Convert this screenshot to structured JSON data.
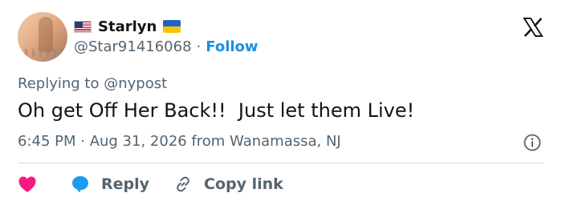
{
  "author": {
    "name": "Starlyn",
    "handle": "@Star91416068",
    "separator": "·",
    "follow_label": "Follow",
    "name_flags": [
      "us-flag-icon",
      "ukraine-flag-icon"
    ]
  },
  "reply_context": {
    "prefix": "Replying to",
    "handle": "@nypost"
  },
  "tweet": {
    "text": "Oh get Off Her Back!!  Just let them Live!",
    "meta": "6:45 PM · Aug 31, 2026 from Wanamassa, NJ"
  },
  "actions": {
    "like_icon": "heart-icon",
    "reply_label": "Reply",
    "copy_link_label": "Copy link"
  },
  "colors": {
    "accent": "#1d9bf0",
    "like": "#f91880",
    "muted": "#536471",
    "text": "#0f1419"
  },
  "icons": [
    "x-logo-icon",
    "info-icon",
    "heart-icon",
    "speech-bubble-icon",
    "link-icon"
  ]
}
